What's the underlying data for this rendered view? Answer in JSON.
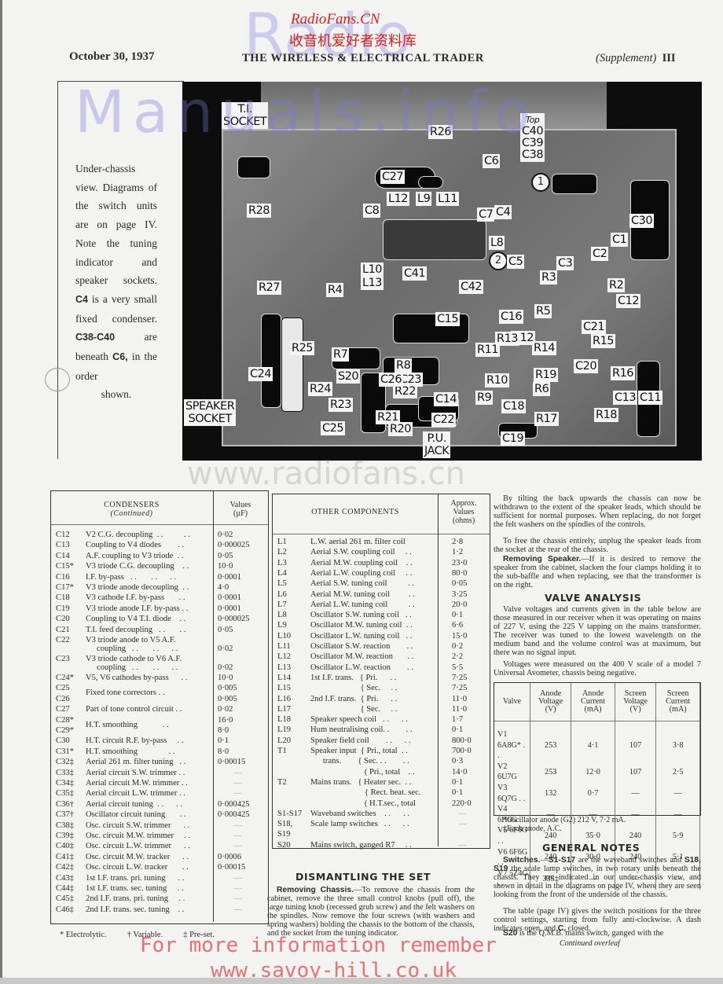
{
  "header": {
    "date": "October 30, 1937",
    "publication": "THE WIRELESS & ELECTRICAL TRADER",
    "supplement": "(Supplement)",
    "page": "III"
  },
  "watermarks": {
    "site_en": "RadioFans.CN",
    "site_cn": "收音机爱好者资料库",
    "radio": "Radio",
    "manuals": "Manuals.info",
    "url": "www.radiofans.cn",
    "footer1": "For more information remember",
    "footer2": "www.savoy-hill.co.uk"
  },
  "caption": {
    "lines": [
      "Under-chassis",
      "view. Diagrams",
      "of the switch",
      "units are on page",
      "IV. Note the",
      "tuning indicator",
      "and speaker",
      "sockets."
    ],
    "c4": "C4",
    "c4_text": " is a very small fixed condenser. ",
    "c38": "C38-C40",
    "c38_text": " are beneath ",
    "c6": "C6,",
    "c6_text": " in the order",
    "last": "shown."
  },
  "photo_labels": {
    "ti_socket": [
      "T.I.",
      "SOCKET"
    ],
    "speaker_socket": [
      "SPEAKER",
      "SOCKET"
    ],
    "pu_jack": [
      "P.U.",
      "JACK"
    ],
    "top_group": [
      "Top",
      "C40",
      "C39",
      "C38"
    ],
    "markers": [
      "1",
      "2"
    ],
    "components": [
      "R26",
      "C27",
      "C6",
      "L12",
      "L9",
      "L11",
      "C8",
      "C7",
      "C4",
      "C30",
      "R28",
      "L8",
      "C1",
      "C2",
      "C5",
      "C3",
      "L10",
      "L13",
      "C41",
      "C42",
      "R3",
      "R2",
      "R27",
      "R4",
      "C12",
      "R5",
      "C16",
      "C15",
      "R7",
      "R25",
      "C21",
      "R12",
      "R13",
      "R15",
      "R8",
      "R11",
      "R14",
      "S20",
      "C24",
      "C20",
      "R16",
      "C23",
      "R19",
      "R10",
      "R22",
      "C14",
      "C26",
      "R6",
      "C13",
      "C11",
      "R24",
      "R9",
      "C18",
      "R17",
      "R18",
      "R23",
      "R21",
      "C22",
      "C25",
      "R20",
      "C19"
    ]
  },
  "condensers_table": {
    "title": "CONDENSERS",
    "subtitle": "(Continued)",
    "value_header": [
      "Values",
      "(µF)"
    ],
    "rows": [
      {
        "ref": "C12",
        "desc": "V2 C.G. decoupling  . .          . .",
        "value": "0·02"
      },
      {
        "ref": "C13",
        "desc": "Coupling to V4 diodes        . .",
        "value": "0·000025"
      },
      {
        "ref": "C14",
        "desc": "A.F. coupling to V3 triode  . .",
        "value": "0·05"
      },
      {
        "ref": "C15*",
        "desc": "V3 triode C.G. decoupling    . .",
        "value": "10·0"
      },
      {
        "ref": "C16",
        "desc": "I.F. by-pass   . .       . .      . .",
        "value": "0·0001"
      },
      {
        "ref": "C17*",
        "desc": "V3 triode anode decoupling  . .",
        "value": "4·0"
      },
      {
        "ref": "C18",
        "desc": "V3 cathode I.F. by-pass       . .",
        "value": "0·0001"
      },
      {
        "ref": "C19",
        "desc": "V3 triode anode I.F. by-pass . .",
        "value": "0·0001"
      },
      {
        "ref": "C20",
        "desc": "Coupling to V4 T.I. diode    . .",
        "value": "0·000025"
      },
      {
        "ref": "C21",
        "desc": "T.I. feed decoupling   . .       . .",
        "value": "0·05"
      },
      {
        "ref": "C22",
        "desc": "V3 triode anode to V5 A.F.",
        "desc2": "coupling   . .       . .      . .",
        "value": "0·02"
      },
      {
        "ref": "C23",
        "desc": "V3 triode cathode to V6 A.F.",
        "desc2": "coupling   . .       . .      . .",
        "value": "0·02"
      },
      {
        "ref": "C24*",
        "desc": "V5, V6 cathodes by-pass      . .",
        "value": "10·0"
      },
      {
        "ref": "C25",
        "desc": "Fixed tone correctors . .",
        "value": "0·005",
        "group": "start"
      },
      {
        "ref": "C26",
        "desc": "",
        "value": "0·005",
        "group": "end"
      },
      {
        "ref": "C27",
        "desc": "Part of tone control circuit . .",
        "value": "0·02"
      },
      {
        "ref": "C28*",
        "desc": "H.T. smoothing            . .",
        "value": "16·0",
        "group": "start"
      },
      {
        "ref": "C29*",
        "desc": "",
        "value": "8·0",
        "group": "end"
      },
      {
        "ref": "C30",
        "desc": "H.T. circuit R.F. by-pass     . .",
        "value": "0·1"
      },
      {
        "ref": "C31*",
        "desc": "H.T. smoothing               . .",
        "value": "8·0"
      },
      {
        "ref": "C32‡",
        "desc": "Aerial 261 m. filter tuning   . .",
        "value": "0·00015"
      },
      {
        "ref": "C33‡",
        "desc": "Aerial circuit S.W. trimmer . .",
        "value": "—"
      },
      {
        "ref": "C34‡",
        "desc": "Aerial circuit M.W. trimmer . .",
        "value": "—"
      },
      {
        "ref": "C35‡",
        "desc": "Aerial circuit L.W. trimmer . .",
        "value": "—"
      },
      {
        "ref": "C36†",
        "desc": "Aerial circuit tuning  . .      . .",
        "value": "0·000425"
      },
      {
        "ref": "C37†",
        "desc": "Oscillator circuit tuning       . .",
        "value": "0·000425"
      },
      {
        "ref": "C38‡",
        "desc": "Osc. circuit S.W. trimmer      . .",
        "value": "—"
      },
      {
        "ref": "C39‡",
        "desc": "Osc. circuit M.W. trimmer     . .",
        "value": "—"
      },
      {
        "ref": "C40‡",
        "desc": "Osc. circuit L.W. trimmer      . .",
        "value": "—"
      },
      {
        "ref": "C41‡",
        "desc": "Osc. circuit M.W. tracker      . .",
        "value": "0·0006"
      },
      {
        "ref": "C42‡",
        "desc": "Osc. circuit L.W. tracker       . .",
        "value": "0·00015"
      },
      {
        "ref": "C43‡",
        "desc": "1st I.F. trans. pri. tuning      . .",
        "value": "—"
      },
      {
        "ref": "C44‡",
        "desc": "1st I.F. trans. sec. tuning     . .",
        "value": "—"
      },
      {
        "ref": "C45‡",
        "desc": "2nd I.F. trans. pri. tuning     . .",
        "value": "—"
      },
      {
        "ref": "C46‡",
        "desc": "2nd I.F. trans. sec. tuning    . .",
        "value": "—"
      }
    ],
    "footnote": "* Electrolytic.          † Variable.          ‡ Pre-set."
  },
  "other_components_table": {
    "title": "OTHER COMPONENTS",
    "value_header": [
      "Approx.",
      "Values",
      "(ohms)"
    ],
    "rows": [
      {
        "ref": "L1",
        "desc": "L.W. aerial 261 m. filter coil",
        "value": "2·8"
      },
      {
        "ref": "L2",
        "desc": "Aerial S.W. coupling coil     . .",
        "value": "1·2"
      },
      {
        "ref": "L3",
        "desc": "Aerial M.W. coupling coil    . .",
        "value": "23·0"
      },
      {
        "ref": "L4",
        "desc": "Aerial L.W. coupling coil     . .",
        "value": "80·0"
      },
      {
        "ref": "L5",
        "desc": "Aerial S.W. tuning coil          . .",
        "value": "0·05"
      },
      {
        "ref": "L6",
        "desc": "Aerial M.W. tuning coil         . .",
        "value": "3·25"
      },
      {
        "ref": "L7",
        "desc": "Aerial L.W. tuning coil          . .",
        "value": "20·0"
      },
      {
        "ref": "L8",
        "desc": "Oscillator S.W. tuning coil   . .",
        "value": "0·1"
      },
      {
        "ref": "L9",
        "desc": "Oscillator M.W. tuning coil  . .",
        "value": "6·6"
      },
      {
        "ref": "L10",
        "desc": "Oscillator L.W. tuning coil   . .",
        "value": "15·0"
      },
      {
        "ref": "L11",
        "desc": "Oscillator S.W. reaction        . .",
        "value": "0·2"
      },
      {
        "ref": "L12",
        "desc": "Oscillator M.W. reaction       . .",
        "value": "2·2"
      },
      {
        "ref": "L13",
        "desc": "Oscillator L.W. reaction        . .",
        "value": "5·5"
      },
      {
        "ref": "L14",
        "desc": "1st I.F. trans.   { Pri.      . .",
        "value": "7·25"
      },
      {
        "ref": "L15",
        "desc": "                        { Sec.     . .",
        "value": "7·25"
      },
      {
        "ref": "L16",
        "desc": "2nd I.F. trans.  { Pri.      . .",
        "value": "11·0"
      },
      {
        "ref": "L17",
        "desc": "                        { Sec.     . .",
        "value": "11·0"
      },
      {
        "ref": "L18",
        "desc": "Speaker speech coil   . .      . .",
        "value": "1·7"
      },
      {
        "ref": "L19",
        "desc": "Hum neutralising coil. .        . .",
        "value": "0·1"
      },
      {
        "ref": "L20",
        "desc": "Speaker field coil        . .      . .",
        "value": "800·0"
      },
      {
        "ref": "T1",
        "desc": "Speaker input  { Pri., total  . .",
        "value": "700·0"
      },
      {
        "ref": "",
        "desc": "      trans.        { Sec. . .        . .",
        "value": "0·3"
      },
      {
        "ref": "",
        "desc": "                          ( Pri., total    . .",
        "value": "14·0"
      },
      {
        "ref": "T2",
        "desc": "Mains trans.   { Heater sec.  . .",
        "value": "0·1"
      },
      {
        "ref": "",
        "desc": "                          { Rect. heat. sec.",
        "value": "0·1"
      },
      {
        "ref": "",
        "desc": "                          ( H.T.sec., total",
        "value": "220·0"
      },
      {
        "ref": "S1-S17",
        "desc": "Waveband switches    . .      . .",
        "value": "—"
      },
      {
        "ref": "S18,",
        "desc": "Scale lamp switches   . .      . .",
        "value": "—"
      },
      {
        "ref": "S19",
        "desc": "",
        "value": ""
      },
      {
        "ref": "S20",
        "desc": "Mains switch, ganged R7     . .",
        "value": "—"
      }
    ]
  },
  "dismantling": {
    "title": "DISMANTLING THE SET",
    "lead": "Removing Chassis.",
    "text": "—To remove the chassis from the cabinet, remove the three small control knobs (pull off), the large tuning knob (recessed grub screw) and the felt washers on the spindles. Now remove the four screws (with washers and spring washers) holding the chassis to the bottom of the chassis, and the socket from the tuning indicator."
  },
  "right_column": {
    "para1": "By tilting the back upwards the chassis can now be withdrawn to the extent of the speaker leads, which should be sufficient for normal purposes. When replacing, do not forget the felt washers on the spindles of the controls.",
    "para2": "To free the chassis entirely, unplug the speaker leads from the socket at the rear of the chassis.",
    "speaker_lead": "Removing Speaker.",
    "speaker_text": "—If it is desired to remove the speaker from the cabinet, slacken the four clamps holding it to the sub-baffle and when replacing, see that the transformer is on the right."
  },
  "valve_analysis": {
    "title": "VALVE ANALYSIS",
    "para1": "Valve voltages and currents given in the table below are those measured in our receiver when it was operating on mains of 227 V, using the 225 V tapping on the mains transformer. The receiver was tuned to the lowest wavelength on the medium band and the volume control was at maximum, but there was no signal input.",
    "para2": "Voltages were measured on the 400 V scale of a model 7 Universal Avometer, chassis being negative.",
    "columns": [
      "Valve",
      "Anode Voltage (V)",
      "Anode Current (mA)",
      "Screen Voltage (V)",
      "Screen Current (mA)"
    ],
    "rows": [
      [
        "V1 6A8G* . .",
        "253",
        "4·1",
        "107",
        "3·8"
      ],
      [
        "V2 6U7G",
        "253",
        "12·0",
        "107",
        "2·5"
      ],
      [
        "V3 6Q7G  . .",
        "132",
        "0·7",
        "—",
        "—"
      ],
      [
        "V4 6H6G",
        "—",
        "—",
        "—",
        "—"
      ],
      [
        "V5 6F6G  . .",
        "240",
        "35·0",
        "240",
        "5·9"
      ],
      [
        "V6 6F6G  . .",
        "240",
        "30·0",
        "240",
        "5·1"
      ],
      [
        "V7 5Z4G  . .",
        "335‡",
        "—",
        "—",
        "—"
      ]
    ],
    "note1": "*Oscillator anode (G2) 212 V, 7·2 mA.",
    "note2": "‡Each anode, A.C."
  },
  "general_notes": {
    "title": "GENERAL NOTES",
    "lead": "Switches.",
    "s1": "S1-S17",
    "t1": " are the waveband switches and ",
    "s2": "S18, S19",
    "t2": " the scale lamp switches, in two rotary units beneath the chassis. They are indicated in our under-chassis view, and shown in detail in the diagrams on page IV, where they are seen looking from the front of the underside of the chassis.",
    "para2a": "The table (page IV) gives the switch positions for the three control settings, starting from fully anti-clockwise. A dash indicates open, and ",
    "c": "C,",
    "para2b": " closed.",
    "s20": "S20",
    "t3": " is the Q.M.B. mains switch, ganged with the",
    "continued": "Continued overleaf"
  }
}
